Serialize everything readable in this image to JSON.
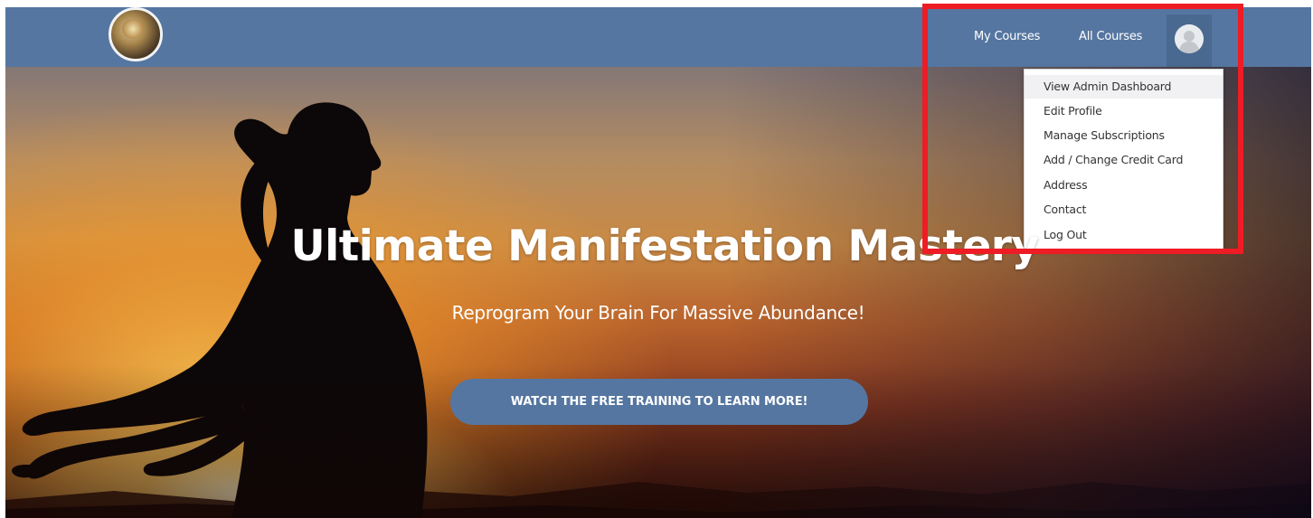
{
  "navbar": {
    "logo_icon": "site-logo",
    "my_courses_label": "My Courses",
    "all_courses_label": "All Courses",
    "avatar_icon": "user-avatar-icon",
    "color": "#5576a0"
  },
  "dropdown": {
    "items": [
      {
        "label": "View Admin Dashboard"
      },
      {
        "label": "Edit Profile"
      },
      {
        "label": "Manage Subscriptions"
      },
      {
        "label": "Add / Change Credit Card"
      },
      {
        "label": "Address"
      },
      {
        "label": "Contact"
      },
      {
        "label": "Log Out"
      }
    ],
    "hovered_item": "View Admin Dashboard"
  },
  "hero": {
    "title": "Ultimate Manifestation Mastery",
    "subtitle": "Reprogram Your Brain For Massive Abundance!",
    "cta_label": "WATCH THE FREE TRAINING TO LEARN MORE!"
  },
  "colors": {
    "highlight": "#ee1c25",
    "button": "#5576a0"
  }
}
